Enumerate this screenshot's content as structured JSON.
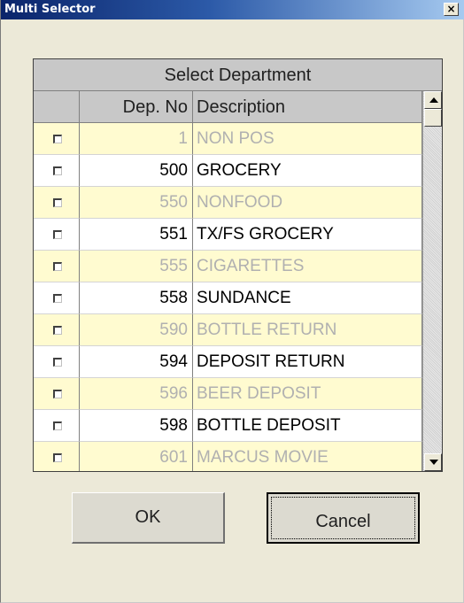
{
  "window": {
    "title": "Multi Selector",
    "close_glyph": "×"
  },
  "grid": {
    "title": "Select Department",
    "headers": {
      "check": "",
      "dep_no": "Dep. No",
      "description": "Description"
    },
    "rows": [
      {
        "checked": false,
        "dep_no": "1",
        "description": "NON POS"
      },
      {
        "checked": false,
        "dep_no": "500",
        "description": "GROCERY"
      },
      {
        "checked": false,
        "dep_no": "550",
        "description": "NONFOOD"
      },
      {
        "checked": false,
        "dep_no": "551",
        "description": "TX/FS GROCERY"
      },
      {
        "checked": false,
        "dep_no": "555",
        "description": "CIGARETTES"
      },
      {
        "checked": false,
        "dep_no": "558",
        "description": "SUNDANCE"
      },
      {
        "checked": false,
        "dep_no": "590",
        "description": "BOTTLE RETURN"
      },
      {
        "checked": false,
        "dep_no": "594",
        "description": "DEPOSIT RETURN"
      },
      {
        "checked": false,
        "dep_no": "596",
        "description": "BEER DEPOSIT"
      },
      {
        "checked": false,
        "dep_no": "598",
        "description": "BOTTLE DEPOSIT"
      },
      {
        "checked": false,
        "dep_no": "601",
        "description": "MARCUS MOVIE"
      }
    ]
  },
  "buttons": {
    "ok": "OK",
    "cancel": "Cancel"
  },
  "colors": {
    "title_bar_start": "#0a246a",
    "alt_row_bg": "#fffbd0",
    "alt_row_text": "#b0b0b0",
    "header_bg": "#c8c8c8"
  },
  "icons": {
    "close": "close-icon",
    "scroll_up": "arrow-up-icon",
    "scroll_down": "arrow-down-icon"
  }
}
